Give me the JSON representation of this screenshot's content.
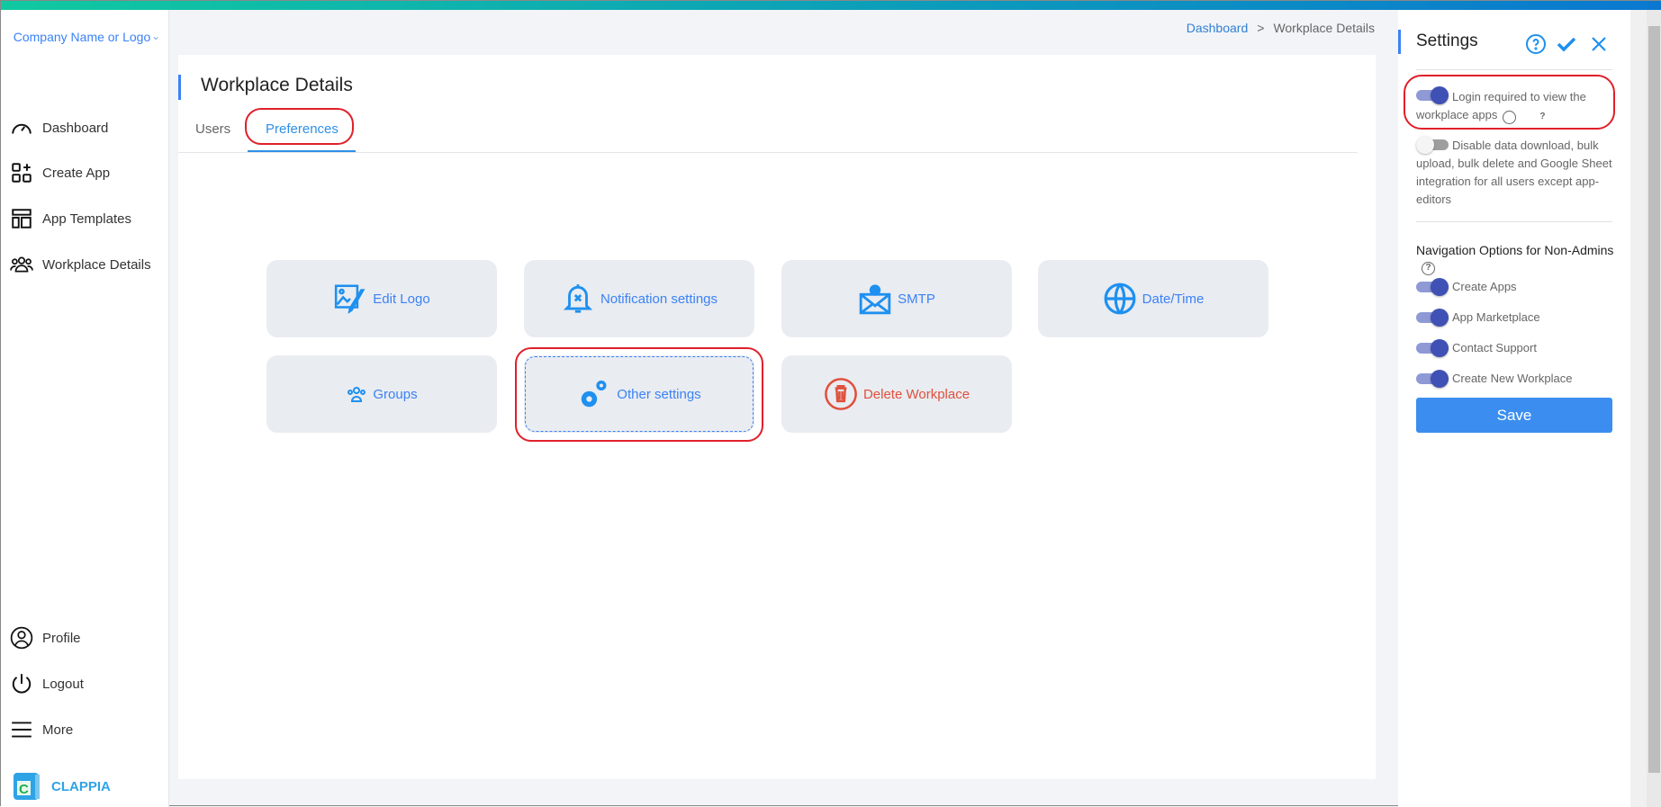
{
  "sidebar": {
    "company": "Company Name or Logo",
    "items": [
      {
        "label": "Dashboard"
      },
      {
        "label": "Create App"
      },
      {
        "label": "App Templates"
      },
      {
        "label": "Workplace Details"
      }
    ],
    "bottom": [
      {
        "label": "Profile"
      },
      {
        "label": "Logout"
      },
      {
        "label": "More"
      }
    ],
    "brand": "CLAPPIA"
  },
  "breadcrumb": {
    "home": "Dashboard",
    "separator": ">",
    "current": "Workplace Details"
  },
  "main": {
    "title": "Workplace Details",
    "tabs": [
      {
        "label": "Users"
      },
      {
        "label": "Preferences"
      }
    ],
    "tiles": [
      {
        "label": "Edit Logo"
      },
      {
        "label": "Notification settings"
      },
      {
        "label": "SMTP"
      },
      {
        "label": "Date/Time"
      },
      {
        "label": "Groups"
      },
      {
        "label": "Other settings"
      },
      {
        "label": "Delete Workplace"
      }
    ]
  },
  "settings": {
    "title": "Settings",
    "login_required": {
      "label": "Login required to view the workplace apps",
      "on": true
    },
    "disable_download": {
      "label": "Disable data download, bulk upload, bulk delete and Google Sheet integration for all users except app-editors",
      "on": false
    },
    "nav_heading": "Navigation Options for Non-Admins",
    "nav_options": [
      {
        "label": "Create Apps",
        "on": true
      },
      {
        "label": "App Marketplace",
        "on": true
      },
      {
        "label": "Contact Support",
        "on": true
      },
      {
        "label": "Create New Workplace",
        "on": true
      }
    ],
    "save_label": "Save",
    "help": "?"
  },
  "colors": {
    "accent": "#3b82f6",
    "danger": "#e0503c",
    "highlight": "#e0202a"
  }
}
